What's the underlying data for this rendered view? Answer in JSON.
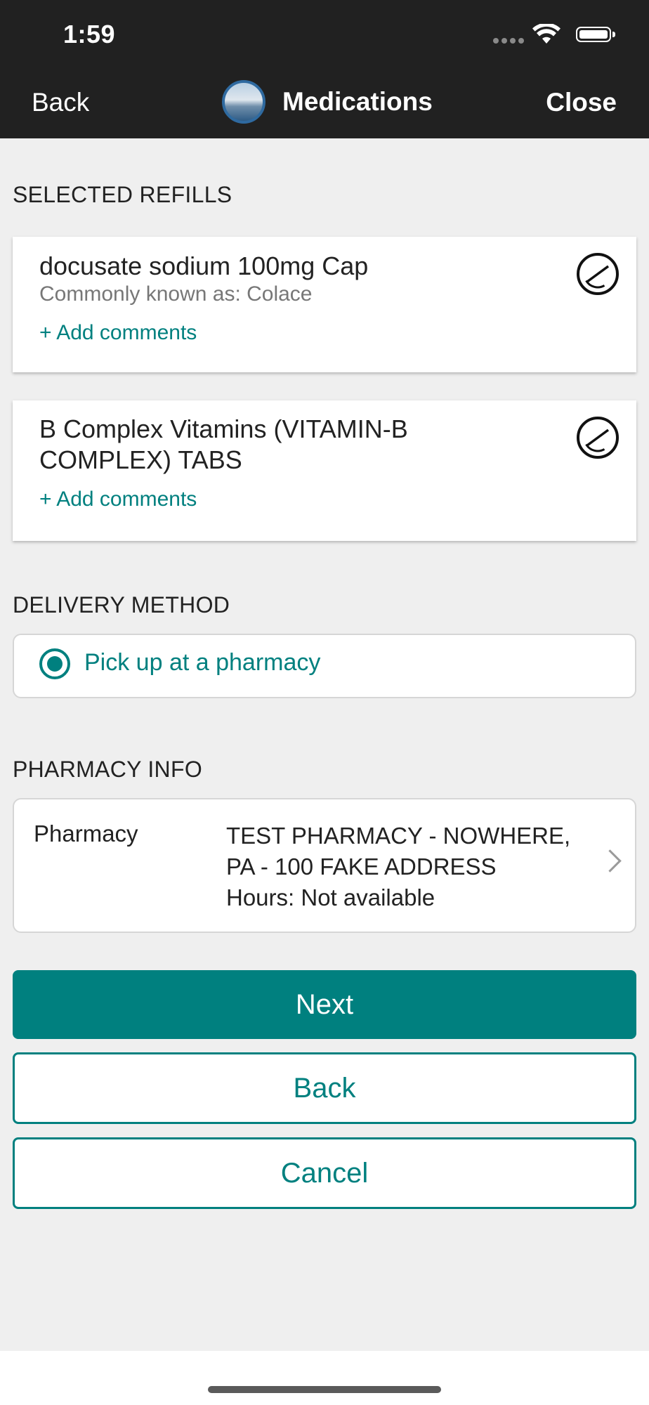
{
  "status_bar": {
    "time": "1:59"
  },
  "nav": {
    "back_label": "Back",
    "title": "Medications",
    "close_label": "Close"
  },
  "selected_refills": {
    "heading": "SELECTED REFILLS",
    "items": [
      {
        "name": "docusate sodium 100mg Cap",
        "subtitle": "Commonly known as: Colace",
        "add_comments": "+ Add comments",
        "icon": "pill-icon"
      },
      {
        "name_line1": "B Complex Vitamins (VITAMIN-B",
        "name_line2": "COMPLEX) TABS",
        "add_comments": "+ Add comments",
        "icon": "pill-icon"
      }
    ]
  },
  "delivery": {
    "heading": "DELIVERY METHOD",
    "option_label": "Pick up at a pharmacy",
    "selected": true
  },
  "pharmacy": {
    "heading": "PHARMACY INFO",
    "label": "Pharmacy",
    "value_line1": "TEST PHARMACY - NOWHERE,",
    "value_line2": "PA - 100 FAKE ADDRESS",
    "hours": "Hours: Not available"
  },
  "buttons": {
    "next": "Next",
    "back": "Back",
    "cancel": "Cancel"
  },
  "colors": {
    "accent": "#00807f",
    "topbar": "#212121",
    "background": "#efefef"
  }
}
